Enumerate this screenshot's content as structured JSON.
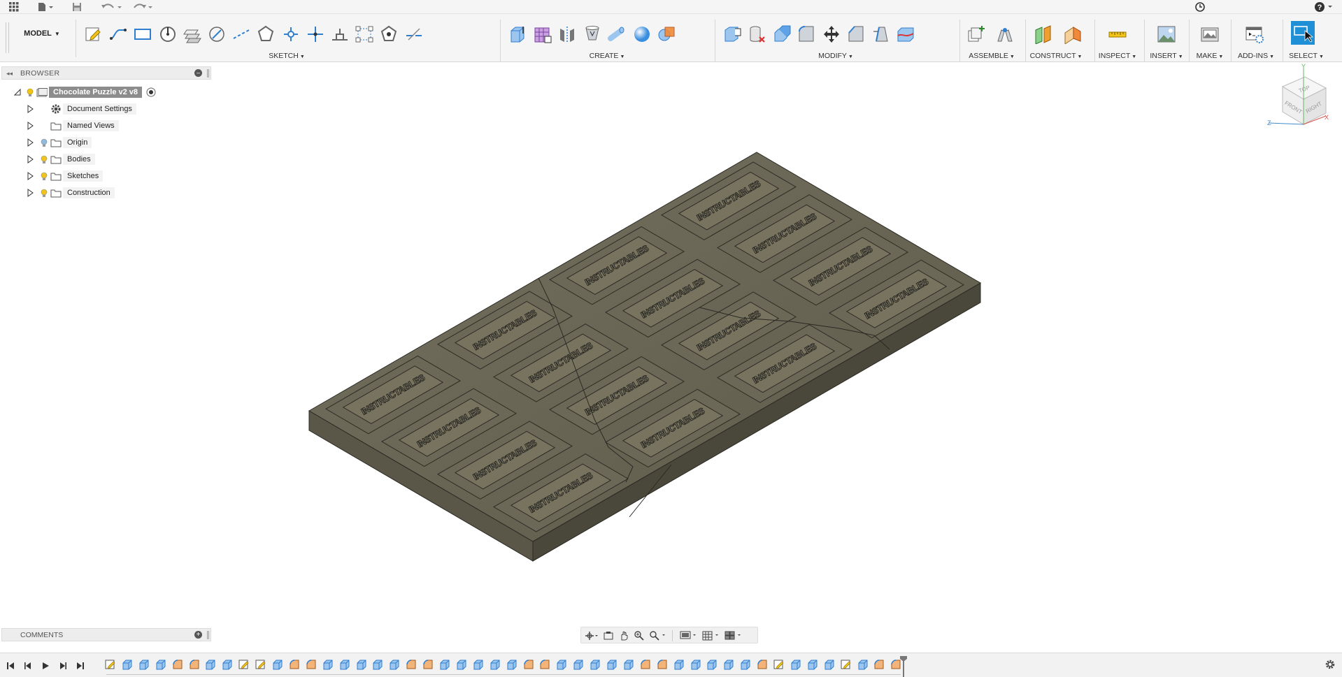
{
  "topbar": {
    "icons": [
      "app-grid-icon",
      "file-menu-icon",
      "save-icon",
      "undo-icon",
      "redo-icon",
      "job-status-icon",
      "help-icon"
    ]
  },
  "ribbon": {
    "workspace_label": "MODEL",
    "groups": [
      {
        "label": "SKETCH",
        "icons": [
          "create-sketch-icon",
          "line-icon",
          "rectangle-icon",
          "circle-icon",
          "offset-icon",
          "arc-icon",
          "construction-line-icon",
          "polygon-icon",
          "spline-icon",
          "point-icon",
          "trim-icon",
          "pattern-icon",
          "project-icon",
          "dash-line-icon"
        ]
      },
      {
        "label": "CREATE",
        "icons": [
          "extrude-icon",
          "form-icon",
          "mirror-icon",
          "loft-icon",
          "pipe-icon",
          "sphere-icon",
          "combine-icon"
        ]
      },
      {
        "label": "MODIFY",
        "icons": [
          "press-pull-icon",
          "delete-icon",
          "shell-icon",
          "fillet-icon",
          "move-icon",
          "chamfer-icon",
          "draft-icon",
          "replace-face-icon"
        ]
      },
      {
        "label": "ASSEMBLE",
        "icons": [
          "new-component-icon",
          "joint-icon"
        ]
      },
      {
        "label": "CONSTRUCT",
        "icons": [
          "offset-plane-icon",
          "plane-at-angle-icon"
        ]
      },
      {
        "label": "INSPECT",
        "icons": [
          "measure-icon"
        ]
      },
      {
        "label": "INSERT",
        "icons": [
          "insert-image-icon"
        ]
      },
      {
        "label": "MAKE",
        "icons": [
          "make-print-icon"
        ]
      },
      {
        "label": "ADD-INS",
        "icons": [
          "scripts-icon"
        ]
      },
      {
        "label": "SELECT",
        "icons": [
          "select-icon"
        ]
      }
    ],
    "accent_color": "#1f8fd6"
  },
  "browser": {
    "title": "BROWSER",
    "root": "Chocolate Puzzle v2 v8",
    "items": [
      {
        "label": "Document Settings",
        "icon": "gear-icon",
        "bulb": false
      },
      {
        "label": "Named Views",
        "icon": "folder-icon",
        "bulb": false
      },
      {
        "label": "Origin",
        "icon": "folder-icon",
        "bulb": true,
        "bulb_color": "#8fbbe0"
      },
      {
        "label": "Bodies",
        "icon": "folder-icon",
        "bulb": true,
        "bulb_color": "#f0c419"
      },
      {
        "label": "Sketches",
        "icon": "folder-icon",
        "bulb": true,
        "bulb_color": "#f0c419"
      },
      {
        "label": "Construction",
        "icon": "folder-icon",
        "bulb": true,
        "bulb_color": "#f0c419"
      }
    ]
  },
  "viewcube": {
    "top": "TOP",
    "front": "FRONT",
    "right": "RIGHT",
    "axis_x": "X",
    "axis_y": "Y",
    "axis_z": "Z"
  },
  "model": {
    "engraving": "INSTRUCTABLES",
    "body_color": "#6a6657"
  },
  "comments": {
    "title": "COMMENTS"
  },
  "navbar": {
    "icons": [
      "orbit-icon",
      "look-at-icon",
      "pan-icon",
      "zoom-window-icon",
      "zoom-icon",
      "display-settings-icon",
      "grid-settings-icon",
      "viewports-icon"
    ]
  },
  "timeline": {
    "controls": [
      "first-frame-icon",
      "prev-frame-icon",
      "play-icon",
      "next-frame-icon",
      "last-frame-icon"
    ],
    "feature_count": 48,
    "settings_icon": "gear-icon"
  }
}
